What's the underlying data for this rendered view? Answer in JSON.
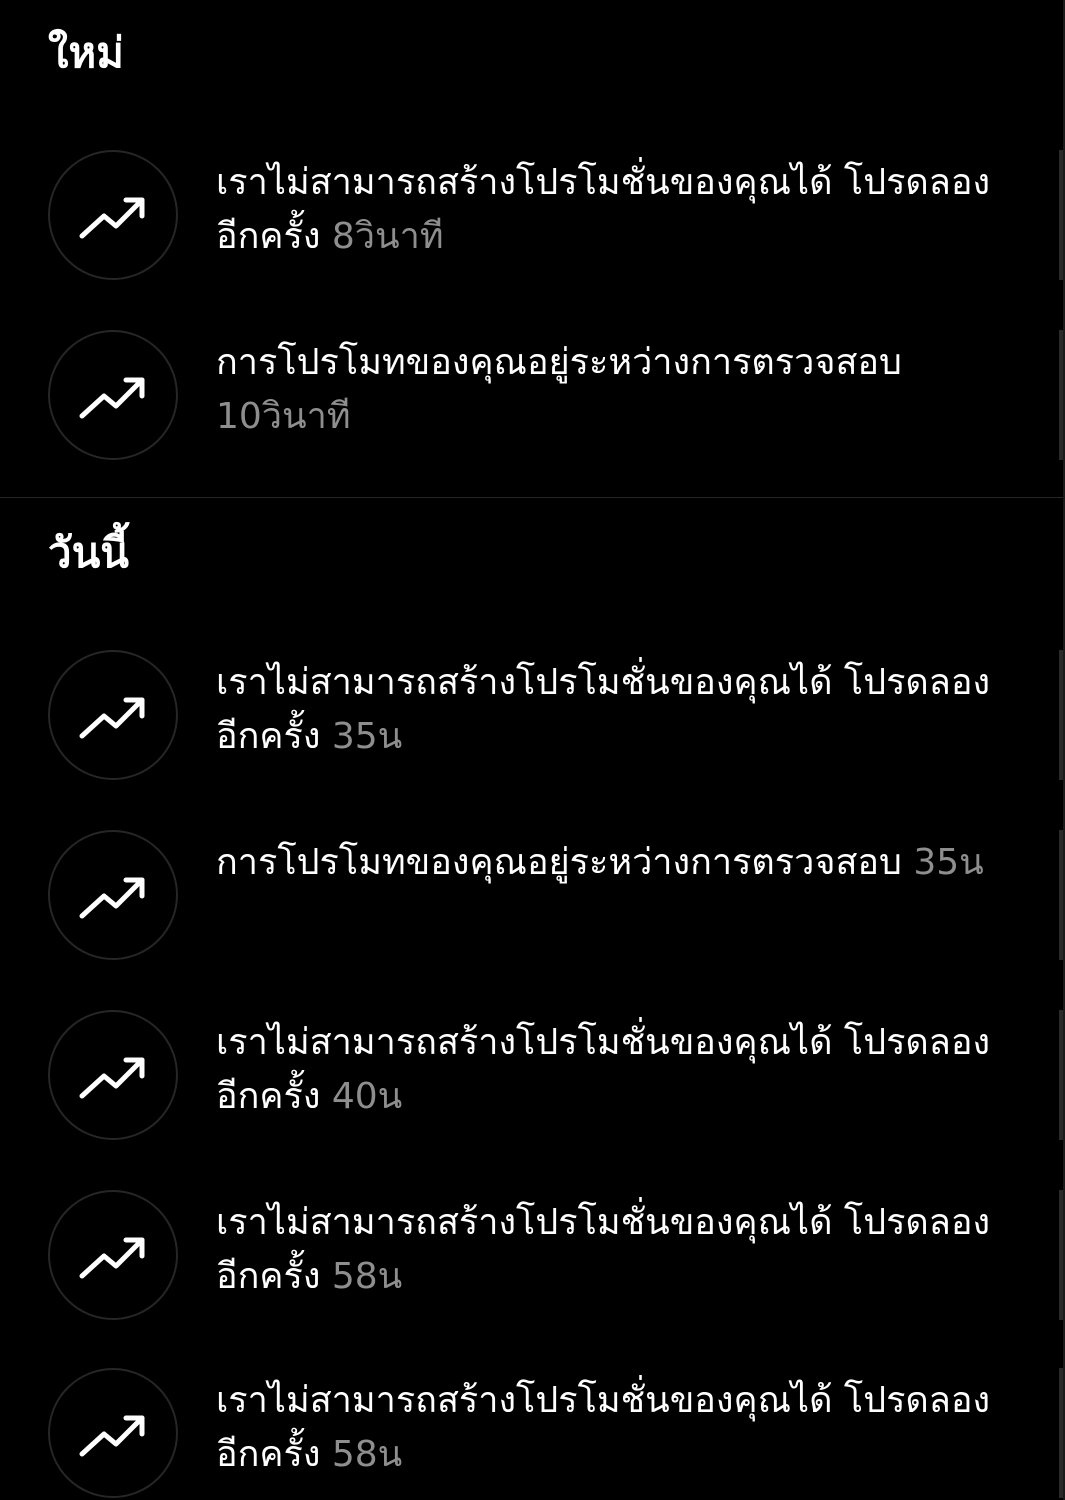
{
  "sections": [
    {
      "title": "ใหม่",
      "items": [
        {
          "message": "เราไม่สามารถสร้างโปรโมชั่นของคุณได้ โปรดลองอีกครั้ง",
          "time": "8วินาที",
          "icon": "trending-up-icon"
        },
        {
          "message": "การโปรโมทของคุณอยู่ระหว่างการตรวจสอบ",
          "time": "10วินาที",
          "icon": "trending-up-icon"
        }
      ]
    },
    {
      "title": "วันนี้",
      "items": [
        {
          "message": "เราไม่สามารถสร้างโปรโมชั่นของคุณได้ โปรดลองอีกครั้ง",
          "time": "35น",
          "icon": "trending-up-icon"
        },
        {
          "message": "การโปรโมทของคุณอยู่ระหว่างการตรวจสอบ",
          "time": "35น",
          "icon": "trending-up-icon"
        },
        {
          "message": "เราไม่สามารถสร้างโปรโมชั่นของคุณได้ โปรดลองอีกครั้ง",
          "time": "40น",
          "icon": "trending-up-icon"
        },
        {
          "message": "เราไม่สามารถสร้างโปรโมชั่นของคุณได้ โปรดลองอีกครั้ง",
          "time": "58น",
          "icon": "trending-up-icon"
        },
        {
          "message": "เราไม่สามารถสร้างโปรโมชั่นของคุณได้ โปรดลองอีกครั้ง",
          "time": "58น",
          "icon": "trending-up-icon"
        }
      ]
    }
  ],
  "colors": {
    "background": "#000000",
    "text": "#ffffff",
    "timestamp": "#8e8e8e",
    "avatar_border": "#262626"
  }
}
